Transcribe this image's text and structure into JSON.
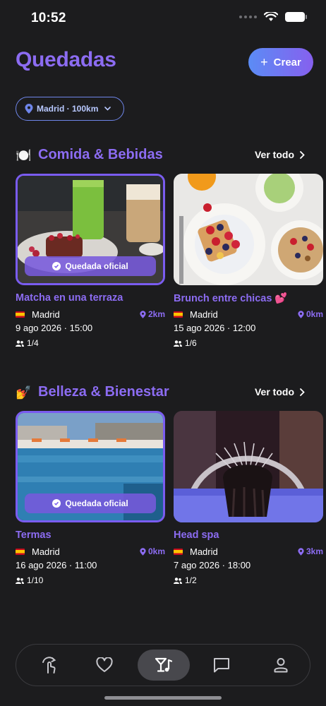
{
  "status_bar": {
    "time": "10:52"
  },
  "header": {
    "title": "Quedadas",
    "create_label": "Crear"
  },
  "location_filter": {
    "label": "Madrid · 100km"
  },
  "sections": [
    {
      "emoji": "🍽️",
      "title": "Comida & Bebidas",
      "see_all": "Ver todo",
      "cards": [
        {
          "title": "Matcha en una terraza",
          "official": true,
          "badge": "Quedada oficial",
          "city": "Madrid",
          "distance": "2km",
          "datetime": "9 ago 2026 · 15:00",
          "attendees": "1/4"
        },
        {
          "title": "Brunch entre chicas 💕",
          "official": false,
          "city": "Madrid",
          "distance": "0km",
          "datetime": "15 ago 2026 · 12:00",
          "attendees": "1/6"
        }
      ]
    },
    {
      "emoji": "💅",
      "title": "Belleza & Bienestar",
      "see_all": "Ver todo",
      "cards": [
        {
          "title": "Termas",
          "official": true,
          "badge": "Quedada oficial",
          "city": "Madrid",
          "distance": "0km",
          "datetime": "16 ago 2026 · 11:00",
          "attendees": "1/10"
        },
        {
          "title": "Head spa",
          "official": false,
          "city": "Madrid",
          "distance": "3km",
          "datetime": "7 ago 2026 · 18:00",
          "attendees": "1/2"
        }
      ]
    }
  ],
  "bottom_nav": {
    "items": [
      {
        "icon": "swipe-icon",
        "active": false
      },
      {
        "icon": "heart-icon",
        "active": false
      },
      {
        "icon": "cocktail-music-icon",
        "active": true
      },
      {
        "icon": "chat-icon",
        "active": false
      },
      {
        "icon": "profile-icon",
        "active": false
      }
    ]
  },
  "colors": {
    "accent": "#8c6cf2",
    "background": "#1c1c1e",
    "button_gradient_start": "#5b8cf5",
    "button_gradient_end": "#8660ee"
  }
}
